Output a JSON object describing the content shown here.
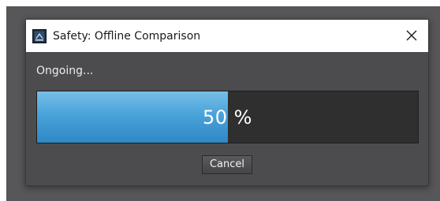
{
  "dialog": {
    "title": "Safety: Offline Comparison",
    "status_text": "Ongoing...",
    "progress": {
      "percent": 50,
      "label": "50 %"
    },
    "cancel_label": "Cancel",
    "icons": {
      "app": "safety-app-icon",
      "close": "close-icon"
    }
  },
  "colors": {
    "backdrop": "#575759",
    "dialog_bg": "#4c4c4f",
    "titlebar_bg": "#ffffff",
    "progress_fill": "#4aa2d9",
    "progress_track": "#2f2f2f"
  }
}
